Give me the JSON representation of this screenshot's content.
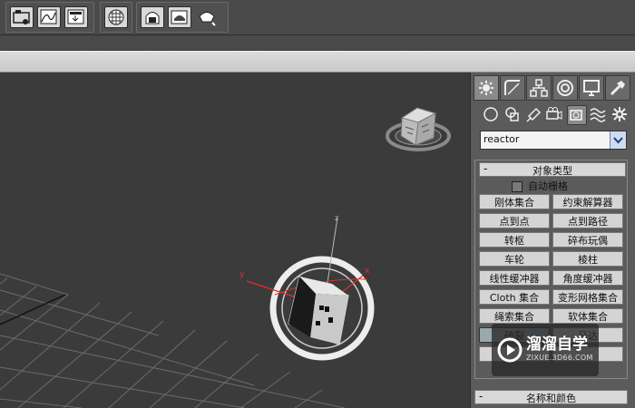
{
  "toolbar": {
    "icons": [
      "schematic-view-icon",
      "curve-editor-icon",
      "render-setup-icon",
      "material-editor-icon",
      "render-frame-icon",
      "render-icon",
      "render-production-icon"
    ]
  },
  "viewport": {
    "axis_x": "x",
    "axis_y": "y",
    "axis_z": "z"
  },
  "command_panel": {
    "tabs": [
      "create-tab",
      "modify-tab",
      "hierarchy-tab",
      "motion-tab",
      "display-tab",
      "utilities-tab"
    ],
    "subtabs": [
      "geometry-subtab",
      "shapes-subtab",
      "lights-subtab",
      "cameras-subtab",
      "helpers-subtab",
      "space-warps-subtab",
      "systems-subtab"
    ],
    "dropdown_value": "reactor",
    "rollout_minus": "-",
    "rollout_title": "对象类型",
    "autogrid_label": "自动栅格",
    "buttons": [
      "刚体集合",
      "约束解算器",
      "点到点",
      "点到路径",
      "转枢",
      "碎布玩偶",
      "车轮",
      "棱柱",
      "线性缓冲器",
      "角度缓冲器",
      "Cloth 集合",
      "变形网格集合",
      "绳索集合",
      "软体集合",
      "破裂",
      "马达"
    ],
    "rollout2_minus": "-",
    "rollout2_title": "名称和颜色"
  },
  "watermark": {
    "brand": "溜溜自学",
    "url": "ZIXUE.3D66.COM"
  },
  "colors": {
    "viewport_bg": "#3b3b3b",
    "grid_line": "#6b6b6b",
    "panel_bg": "#5b5b5b",
    "button_bg": "#d4d4d4",
    "axis_red": "#e0302b"
  }
}
